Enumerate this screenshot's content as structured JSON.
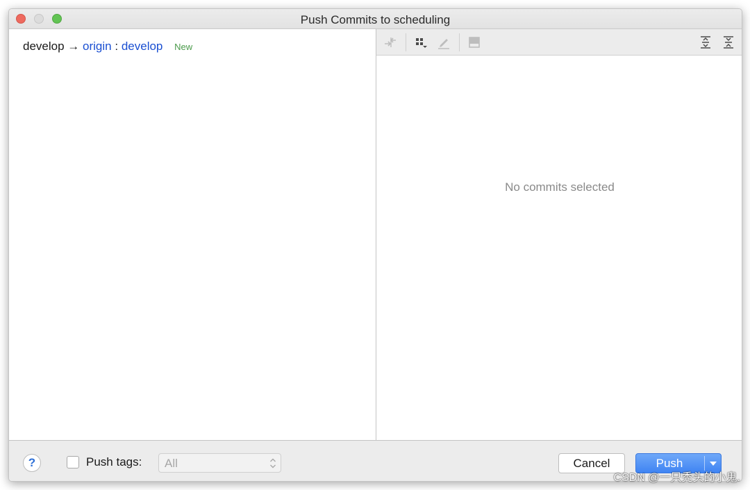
{
  "window": {
    "title": "Push Commits to scheduling"
  },
  "branch": {
    "local": "develop",
    "arrow": "→",
    "remote": "origin",
    "separator": ":",
    "remote_branch": "develop",
    "badge": "New"
  },
  "details": {
    "empty_message": "No commits selected"
  },
  "toolbar": {
    "icons": [
      "compare-icon",
      "group-icon",
      "edit-icon",
      "preview-icon",
      "expand-all-icon",
      "collapse-all-icon"
    ]
  },
  "footer": {
    "help_label": "?",
    "push_tags_label": "Push tags:",
    "push_tags_checked": false,
    "tags_select_value": "All",
    "cancel_label": "Cancel",
    "push_label": "Push"
  },
  "watermark": "CSDN @一只秃头的小鬼.",
  "colors": {
    "link": "#1a4fd2",
    "badge_new": "#4a9a4a",
    "primary_button": "#3f84f3",
    "traffic_close": "#ee6a5f",
    "traffic_max": "#62c454"
  }
}
